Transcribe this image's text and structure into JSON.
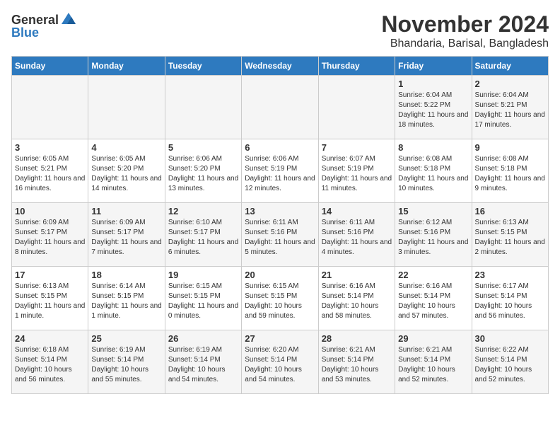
{
  "logo": {
    "general": "General",
    "blue": "Blue"
  },
  "title": "November 2024",
  "location": "Bhandaria, Barisal, Bangladesh",
  "headers": [
    "Sunday",
    "Monday",
    "Tuesday",
    "Wednesday",
    "Thursday",
    "Friday",
    "Saturday"
  ],
  "weeks": [
    [
      {
        "day": "",
        "info": ""
      },
      {
        "day": "",
        "info": ""
      },
      {
        "day": "",
        "info": ""
      },
      {
        "day": "",
        "info": ""
      },
      {
        "day": "",
        "info": ""
      },
      {
        "day": "1",
        "info": "Sunrise: 6:04 AM\nSunset: 5:22 PM\nDaylight: 11 hours and 18 minutes."
      },
      {
        "day": "2",
        "info": "Sunrise: 6:04 AM\nSunset: 5:21 PM\nDaylight: 11 hours and 17 minutes."
      }
    ],
    [
      {
        "day": "3",
        "info": "Sunrise: 6:05 AM\nSunset: 5:21 PM\nDaylight: 11 hours and 16 minutes."
      },
      {
        "day": "4",
        "info": "Sunrise: 6:05 AM\nSunset: 5:20 PM\nDaylight: 11 hours and 14 minutes."
      },
      {
        "day": "5",
        "info": "Sunrise: 6:06 AM\nSunset: 5:20 PM\nDaylight: 11 hours and 13 minutes."
      },
      {
        "day": "6",
        "info": "Sunrise: 6:06 AM\nSunset: 5:19 PM\nDaylight: 11 hours and 12 minutes."
      },
      {
        "day": "7",
        "info": "Sunrise: 6:07 AM\nSunset: 5:19 PM\nDaylight: 11 hours and 11 minutes."
      },
      {
        "day": "8",
        "info": "Sunrise: 6:08 AM\nSunset: 5:18 PM\nDaylight: 11 hours and 10 minutes."
      },
      {
        "day": "9",
        "info": "Sunrise: 6:08 AM\nSunset: 5:18 PM\nDaylight: 11 hours and 9 minutes."
      }
    ],
    [
      {
        "day": "10",
        "info": "Sunrise: 6:09 AM\nSunset: 5:17 PM\nDaylight: 11 hours and 8 minutes."
      },
      {
        "day": "11",
        "info": "Sunrise: 6:09 AM\nSunset: 5:17 PM\nDaylight: 11 hours and 7 minutes."
      },
      {
        "day": "12",
        "info": "Sunrise: 6:10 AM\nSunset: 5:17 PM\nDaylight: 11 hours and 6 minutes."
      },
      {
        "day": "13",
        "info": "Sunrise: 6:11 AM\nSunset: 5:16 PM\nDaylight: 11 hours and 5 minutes."
      },
      {
        "day": "14",
        "info": "Sunrise: 6:11 AM\nSunset: 5:16 PM\nDaylight: 11 hours and 4 minutes."
      },
      {
        "day": "15",
        "info": "Sunrise: 6:12 AM\nSunset: 5:16 PM\nDaylight: 11 hours and 3 minutes."
      },
      {
        "day": "16",
        "info": "Sunrise: 6:13 AM\nSunset: 5:15 PM\nDaylight: 11 hours and 2 minutes."
      }
    ],
    [
      {
        "day": "17",
        "info": "Sunrise: 6:13 AM\nSunset: 5:15 PM\nDaylight: 11 hours and 1 minute."
      },
      {
        "day": "18",
        "info": "Sunrise: 6:14 AM\nSunset: 5:15 PM\nDaylight: 11 hours and 1 minute."
      },
      {
        "day": "19",
        "info": "Sunrise: 6:15 AM\nSunset: 5:15 PM\nDaylight: 11 hours and 0 minutes."
      },
      {
        "day": "20",
        "info": "Sunrise: 6:15 AM\nSunset: 5:15 PM\nDaylight: 10 hours and 59 minutes."
      },
      {
        "day": "21",
        "info": "Sunrise: 6:16 AM\nSunset: 5:14 PM\nDaylight: 10 hours and 58 minutes."
      },
      {
        "day": "22",
        "info": "Sunrise: 6:16 AM\nSunset: 5:14 PM\nDaylight: 10 hours and 57 minutes."
      },
      {
        "day": "23",
        "info": "Sunrise: 6:17 AM\nSunset: 5:14 PM\nDaylight: 10 hours and 56 minutes."
      }
    ],
    [
      {
        "day": "24",
        "info": "Sunrise: 6:18 AM\nSunset: 5:14 PM\nDaylight: 10 hours and 56 minutes."
      },
      {
        "day": "25",
        "info": "Sunrise: 6:19 AM\nSunset: 5:14 PM\nDaylight: 10 hours and 55 minutes."
      },
      {
        "day": "26",
        "info": "Sunrise: 6:19 AM\nSunset: 5:14 PM\nDaylight: 10 hours and 54 minutes."
      },
      {
        "day": "27",
        "info": "Sunrise: 6:20 AM\nSunset: 5:14 PM\nDaylight: 10 hours and 54 minutes."
      },
      {
        "day": "28",
        "info": "Sunrise: 6:21 AM\nSunset: 5:14 PM\nDaylight: 10 hours and 53 minutes."
      },
      {
        "day": "29",
        "info": "Sunrise: 6:21 AM\nSunset: 5:14 PM\nDaylight: 10 hours and 52 minutes."
      },
      {
        "day": "30",
        "info": "Sunrise: 6:22 AM\nSunset: 5:14 PM\nDaylight: 10 hours and 52 minutes."
      }
    ]
  ]
}
